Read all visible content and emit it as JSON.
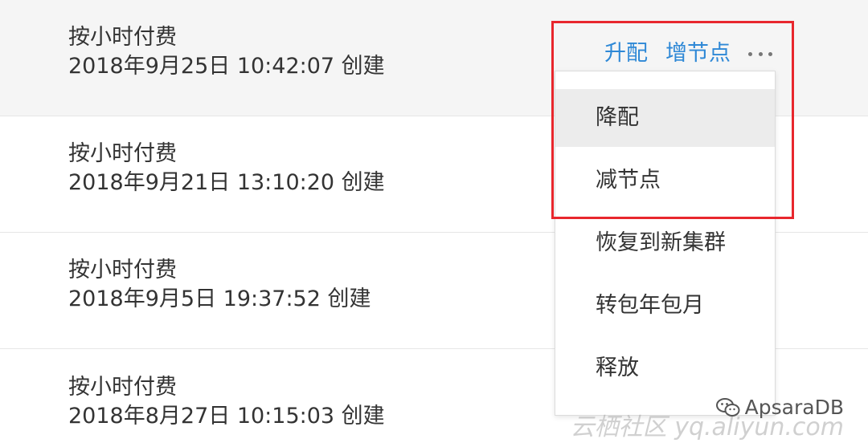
{
  "rows": [
    {
      "billing": "按小时付费",
      "created": "2018年9月25日 10:42:07 创建"
    },
    {
      "billing": "按小时付费",
      "created": "2018年9月21日 13:10:20 创建"
    },
    {
      "billing": "按小时付费",
      "created": "2018年9月5日 19:37:52 创建"
    },
    {
      "billing": "按小时付费",
      "created": "2018年8月27日 10:15:03 创建"
    }
  ],
  "actions": {
    "upgrade": "升配",
    "add_node": "增节点",
    "more_icon": "more-horizontal-icon"
  },
  "dropdown": {
    "items": [
      {
        "label": "降配"
      },
      {
        "label": "减节点"
      },
      {
        "label": "恢复到新集群"
      },
      {
        "label": "转包年包月"
      },
      {
        "label": "释放"
      }
    ]
  },
  "watermark": {
    "brand": "ApsaraDB",
    "site": "云栖社区 yq.aliyun.com",
    "icon": "wechat-icon"
  },
  "colors": {
    "link": "#2e88d6",
    "highlight_box": "#e8272d",
    "row_hover": "#f5f5f5",
    "text": "#333333"
  }
}
